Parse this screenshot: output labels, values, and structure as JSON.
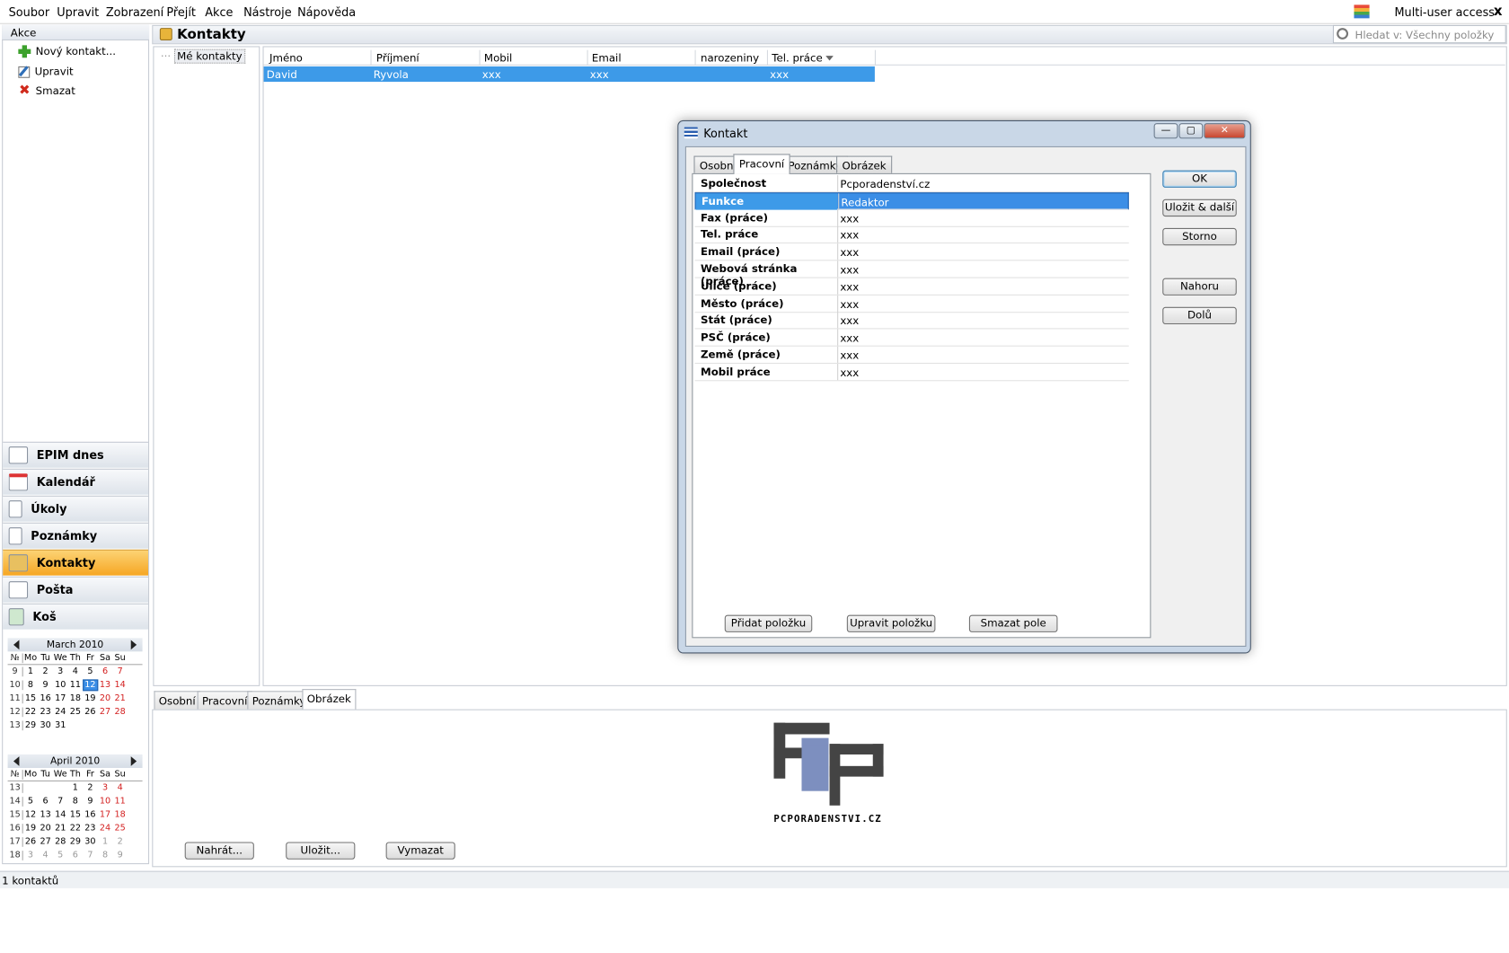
{
  "menu": [
    "Soubor",
    "Upravit",
    "Zobrazení",
    "Přejít",
    "Akce",
    "Nástroje",
    "Nápověda"
  ],
  "multi_user": "Multi-user access",
  "close_glyph": "x",
  "actions": {
    "header": "Akce",
    "items": [
      "Nový kontakt...",
      "Upravit",
      "Smazat"
    ]
  },
  "nav": [
    "EPIM dnes",
    "Kalendář",
    "Úkoly",
    "Poznámky",
    "Kontakty",
    "Pošta",
    "Koš"
  ],
  "nav_active": "Kontakty",
  "calendar": {
    "march": {
      "title": "March  2010",
      "week_hdr": "№",
      "dow": [
        "Mo",
        "Tu",
        "We",
        "Th",
        "Fr",
        "Sa",
        "Su"
      ],
      "weeks": [
        {
          "wk": "9",
          "days": [
            "1",
            "2",
            "3",
            "4",
            "5",
            "6",
            "7"
          ]
        },
        {
          "wk": "10",
          "days": [
            "8",
            "9",
            "10",
            "11",
            "12",
            "13",
            "14"
          ]
        },
        {
          "wk": "11",
          "days": [
            "15",
            "16",
            "17",
            "18",
            "19",
            "20",
            "21"
          ]
        },
        {
          "wk": "12",
          "days": [
            "22",
            "23",
            "24",
            "25",
            "26",
            "27",
            "28"
          ]
        },
        {
          "wk": "13",
          "days": [
            "29",
            "30",
            "31",
            "",
            "",
            "",
            ""
          ]
        }
      ],
      "selected": "12"
    },
    "april": {
      "title": "April  2010",
      "week_hdr": "№",
      "dow": [
        "Mo",
        "Tu",
        "We",
        "Th",
        "Fr",
        "Sa",
        "Su"
      ],
      "weeks": [
        {
          "wk": "13",
          "days": [
            "",
            "",
            "",
            "1",
            "2",
            "3",
            "4"
          ]
        },
        {
          "wk": "14",
          "days": [
            "5",
            "6",
            "7",
            "8",
            "9",
            "10",
            "11"
          ]
        },
        {
          "wk": "15",
          "days": [
            "12",
            "13",
            "14",
            "15",
            "16",
            "17",
            "18"
          ]
        },
        {
          "wk": "16",
          "days": [
            "19",
            "20",
            "21",
            "22",
            "23",
            "24",
            "25"
          ]
        },
        {
          "wk": "17",
          "days": [
            "26",
            "27",
            "28",
            "29",
            "30",
            "1",
            "2"
          ]
        },
        {
          "wk": "18",
          "days": [
            "3",
            "4",
            "5",
            "6",
            "7",
            "8",
            "9"
          ]
        }
      ]
    }
  },
  "header": {
    "title": "Kontakty",
    "search_placeholder": "Hledat v: Všechny položky"
  },
  "folders": {
    "item": "Mé kontakty"
  },
  "grid": {
    "columns": [
      "Jméno",
      "Příjmení",
      "Mobil",
      "Email",
      "narozeniny",
      "Tel. práce"
    ],
    "rows": [
      [
        "David",
        "Ryvola",
        "xxx",
        "xxx",
        "",
        "xxx"
      ]
    ]
  },
  "dialog": {
    "title": "Kontakt",
    "win_buttons": {
      "min": "—",
      "max": "▢",
      "close": "✕"
    },
    "tabs": [
      "Osobní",
      "Pracovní",
      "Poznámky",
      "Obrázek"
    ],
    "active_tab": "Pracovní",
    "fields": [
      {
        "key": "Společnost",
        "value": "Pcporadenství.cz"
      },
      {
        "key": "Funkce",
        "value": "Redaktor"
      },
      {
        "key": "Fax (práce)",
        "value": "xxx"
      },
      {
        "key": "Tel. práce",
        "value": "xxx"
      },
      {
        "key": "Email (práce)",
        "value": "xxx"
      },
      {
        "key": "Webová stránka (práce)",
        "value": "xxx"
      },
      {
        "key": "Ulice (práce)",
        "value": "xxx"
      },
      {
        "key": "Město (práce)",
        "value": "xxx"
      },
      {
        "key": "Stát (práce)",
        "value": "xxx"
      },
      {
        "key": "PSČ (práce)",
        "value": "xxx"
      },
      {
        "key": "Země (práce)",
        "value": "xxx"
      },
      {
        "key": "Mobil práce",
        "value": "xxx"
      }
    ],
    "selected_field": "Funkce",
    "side_buttons": [
      "OK",
      "Uložit & další",
      "Storno",
      "Nahoru",
      "Dolů"
    ],
    "bottom_buttons": [
      "Přidat položku",
      "Upravit položku",
      "Smazat pole"
    ]
  },
  "bottom": {
    "tabs": [
      "Osobní",
      "Pracovní",
      "Poznámky",
      "Obrázek"
    ],
    "active_tab": "Obrázek",
    "logo_text": "PCPORADENSTVI.CZ",
    "buttons": [
      "Nahrát...",
      "Uložit...",
      "Vymazat"
    ]
  },
  "status": "1 kontaktů",
  "colors": {
    "selection": "#3d9ae8",
    "nav_active": "#f6a623",
    "weekend": "#d32020"
  }
}
